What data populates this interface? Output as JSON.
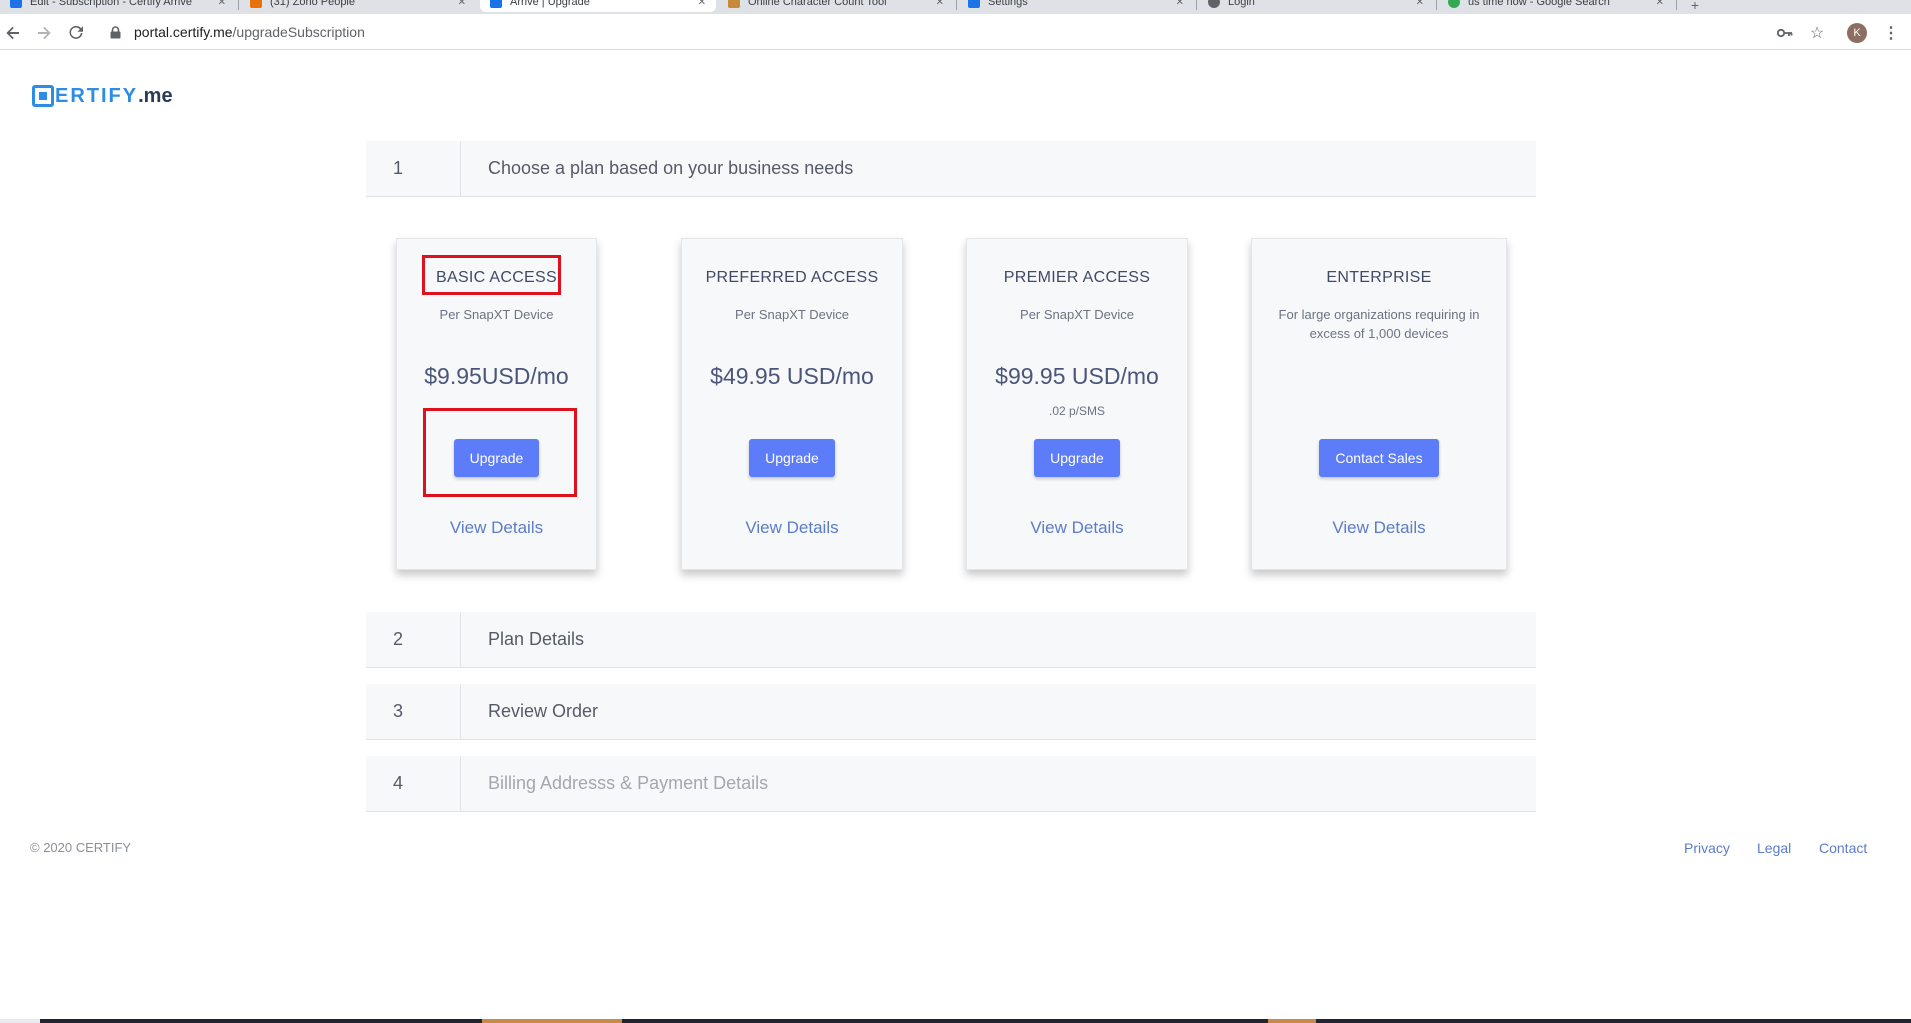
{
  "browser": {
    "tabs": [
      {
        "title": "Edit - Subscription - Certify Arrive",
        "color": "#1a73e8"
      },
      {
        "title": "(31) Zoho People",
        "color": "#e8710a"
      },
      {
        "title": "Arrive | Upgrade",
        "color": "#1a73e8"
      },
      {
        "title": "Online Character Count Tool",
        "color": "#c78a3b"
      },
      {
        "title": "Settings",
        "color": "#1a73e8"
      },
      {
        "title": "Login",
        "color": "#5f6368"
      },
      {
        "title": "us time now - Google Search",
        "color": "#34a853"
      }
    ],
    "url_host": "portal.certify.me",
    "url_path": "/upgradeSubscription",
    "avatar_letter": "K"
  },
  "logo": {
    "word": "ERTIFY",
    "suffix": ".me"
  },
  "steps": [
    {
      "num": "1",
      "title": "Choose a plan based on your business needs"
    },
    {
      "num": "2",
      "title": "Plan Details"
    },
    {
      "num": "3",
      "title": "Review Order"
    },
    {
      "num": "4",
      "title": "Billing Addresss & Payment Details"
    }
  ],
  "plans": [
    {
      "name": "BASIC ACCESS",
      "sub": "Per SnapXT Device",
      "price": "$9.95USD/mo",
      "extra": "",
      "button": "Upgrade",
      "details": "View Details"
    },
    {
      "name": "PREFERRED ACCESS",
      "sub": "Per SnapXT Device",
      "price": "$49.95 USD/mo",
      "extra": "",
      "button": "Upgrade",
      "details": "View Details"
    },
    {
      "name": "PREMIER ACCESS",
      "sub": "Per SnapXT Device",
      "price": "$99.95 USD/mo",
      "extra": ".02 p/SMS",
      "button": "Upgrade",
      "details": "View Details"
    },
    {
      "name": "ENTERPRISE",
      "sub": "For large organizations requiring in excess of 1,000 devices",
      "price": "",
      "extra": "",
      "button": "Contact Sales",
      "details": "View Details"
    }
  ],
  "footer": {
    "copyright": "© 2020 CERTIFY",
    "links": [
      "Privacy",
      "Legal",
      "Contact"
    ]
  }
}
